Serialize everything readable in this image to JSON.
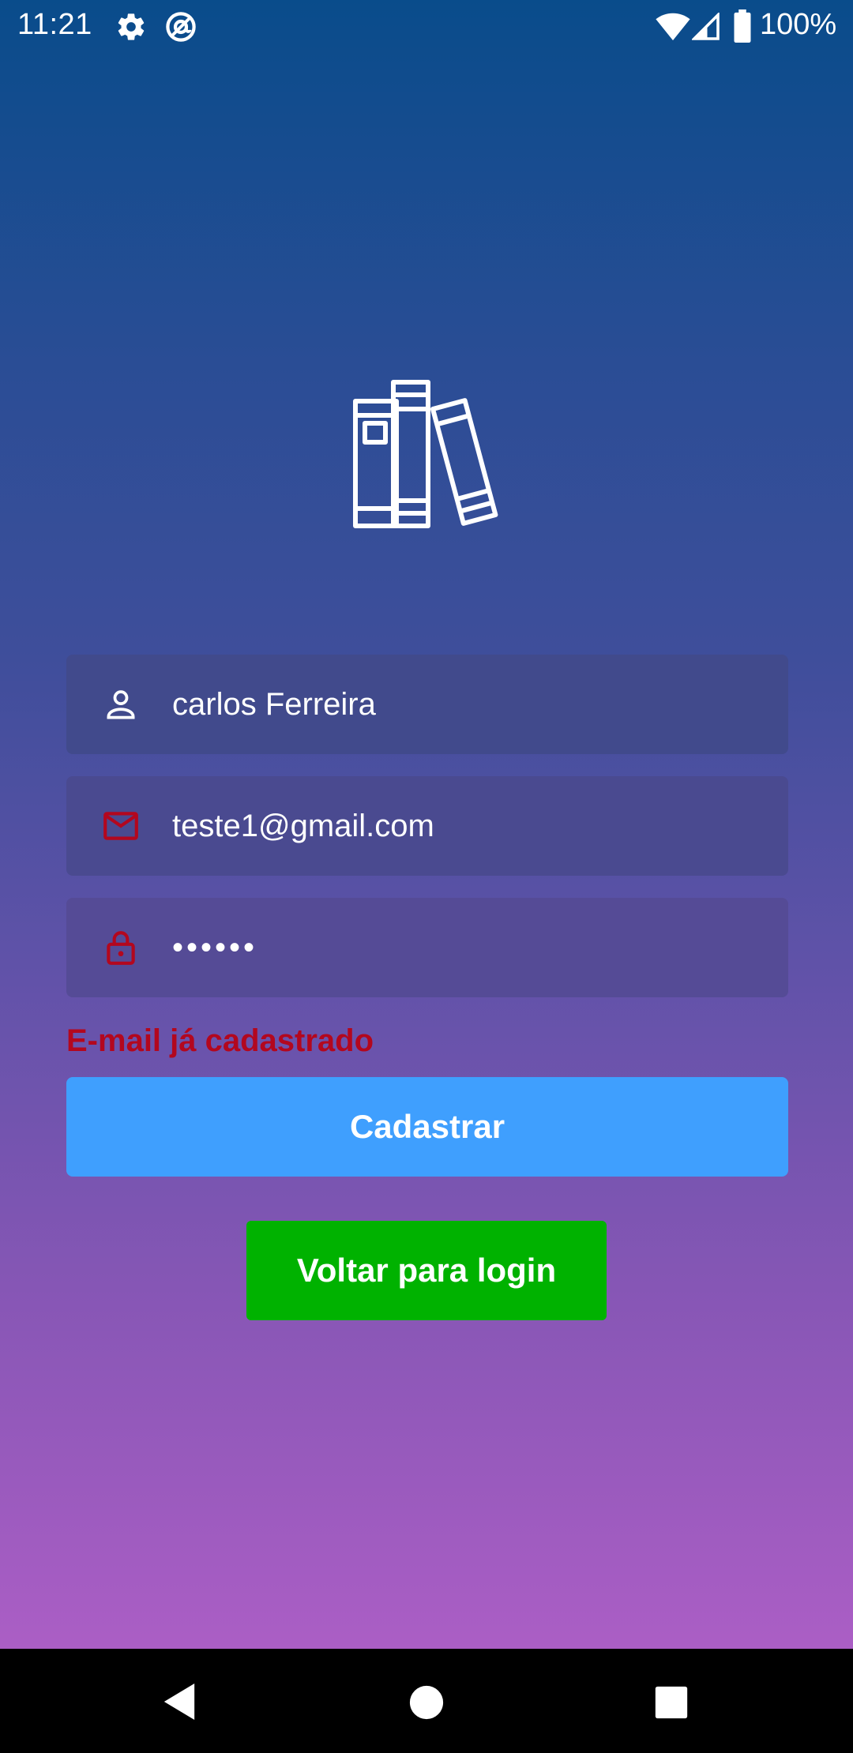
{
  "status_bar": {
    "time": "11:21",
    "battery": "100%",
    "icons": [
      "settings-icon",
      "at-sign-icon",
      "wifi-icon",
      "cell-signal-icon",
      "battery-icon"
    ]
  },
  "logo": {
    "icon": "books-icon"
  },
  "form": {
    "name": {
      "value": "carlos Ferreira",
      "icon": "person-icon"
    },
    "email": {
      "value": "teste1@gmail.com",
      "icon": "mail-icon"
    },
    "password": {
      "value": "••••••",
      "icon": "lock-icon"
    },
    "error": "E-mail já cadastrado",
    "submit_label": "Cadastrar",
    "back_label": "Voltar para login"
  },
  "nav_bar": {
    "icons": [
      "back-icon",
      "home-icon",
      "recents-icon"
    ]
  },
  "colors": {
    "gradient_top": "#094c8b",
    "gradient_bottom": "#ab5ec5",
    "error": "#b3071e",
    "primary_button": "#3f9ffe",
    "secondary_button": "#00b200"
  }
}
